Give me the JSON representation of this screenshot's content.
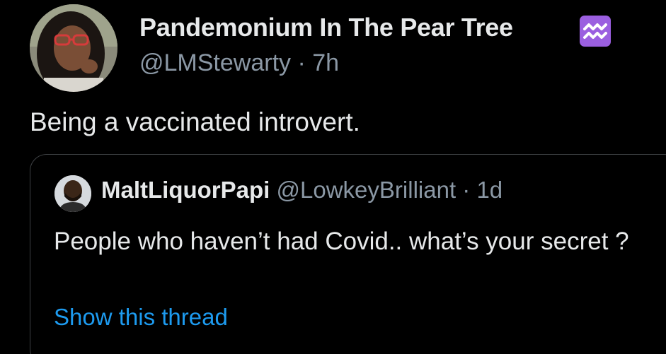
{
  "tweet": {
    "display_name": "Pandemonium In The Pear Tree",
    "badge_icon": "aquarius-icon",
    "badge_color": "#9b5fe0",
    "handle": "@LMStewarty",
    "separator": "·",
    "time": "7h",
    "text": "Being a vaccinated introvert."
  },
  "quoted_tweet": {
    "display_name": "MaltLiquorPapi",
    "handle": "@LowkeyBrilliant",
    "separator": "·",
    "time": "1d",
    "text": "People who haven’t had Covid.. what’s your secret ?",
    "thread_link": "Show this thread",
    "link_color": "#1d9bf0"
  }
}
